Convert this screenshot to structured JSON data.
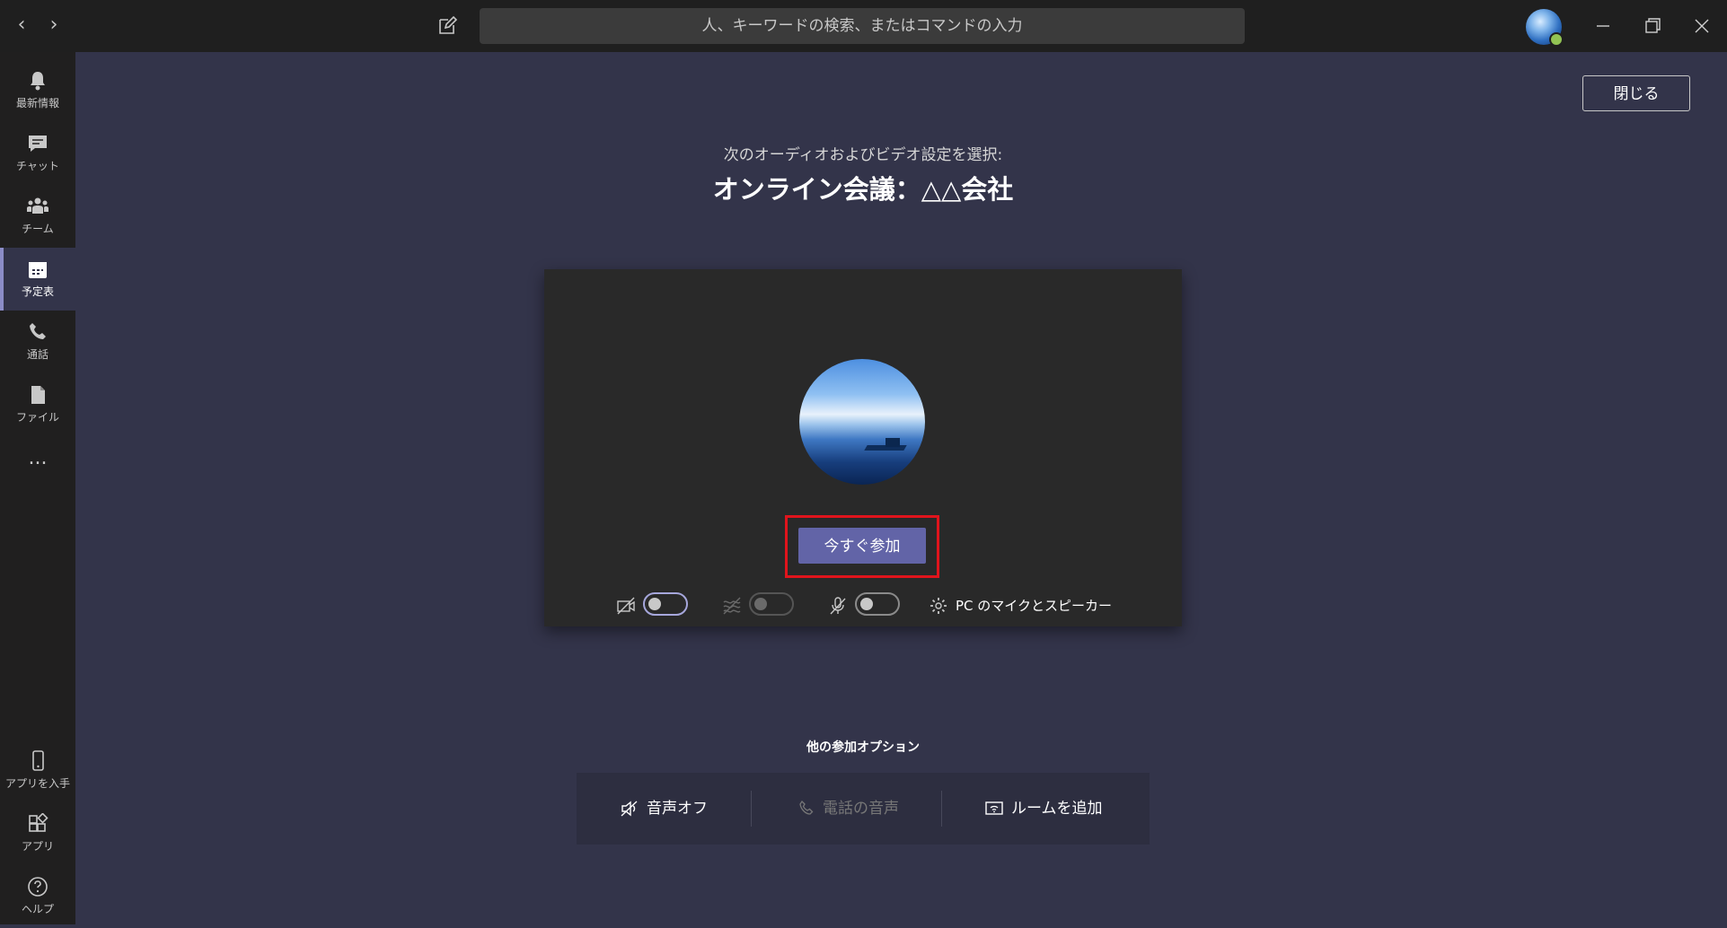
{
  "titlebar": {
    "search_placeholder": "人、キーワードの検索、またはコマンドの入力"
  },
  "rail": {
    "items": [
      {
        "label": "最新情報"
      },
      {
        "label": "チャット"
      },
      {
        "label": "チーム"
      },
      {
        "label": "予定表"
      },
      {
        "label": "通話"
      },
      {
        "label": "ファイル"
      },
      {
        "label": "..."
      }
    ],
    "bottom_items": [
      {
        "label": "アプリを入手"
      },
      {
        "label": "アプリ"
      },
      {
        "label": "ヘルプ"
      }
    ]
  },
  "main": {
    "close_label": "閉じる",
    "subtitle": "次のオーディオおよびビデオ設定を選択:",
    "meeting_title": "オンライン会議：△△会社",
    "join_label": "今すぐ参加",
    "device_label": "PC のマイクとスピーカー",
    "other_options_title": "他の参加オプション",
    "options": [
      {
        "label": "音声オフ"
      },
      {
        "label": "電話の音声"
      },
      {
        "label": "ルームを追加"
      }
    ]
  },
  "colors": {
    "accent": "#6264a7",
    "highlight": "#e0141c",
    "background": "#33344a",
    "rail": "#201f1f"
  }
}
